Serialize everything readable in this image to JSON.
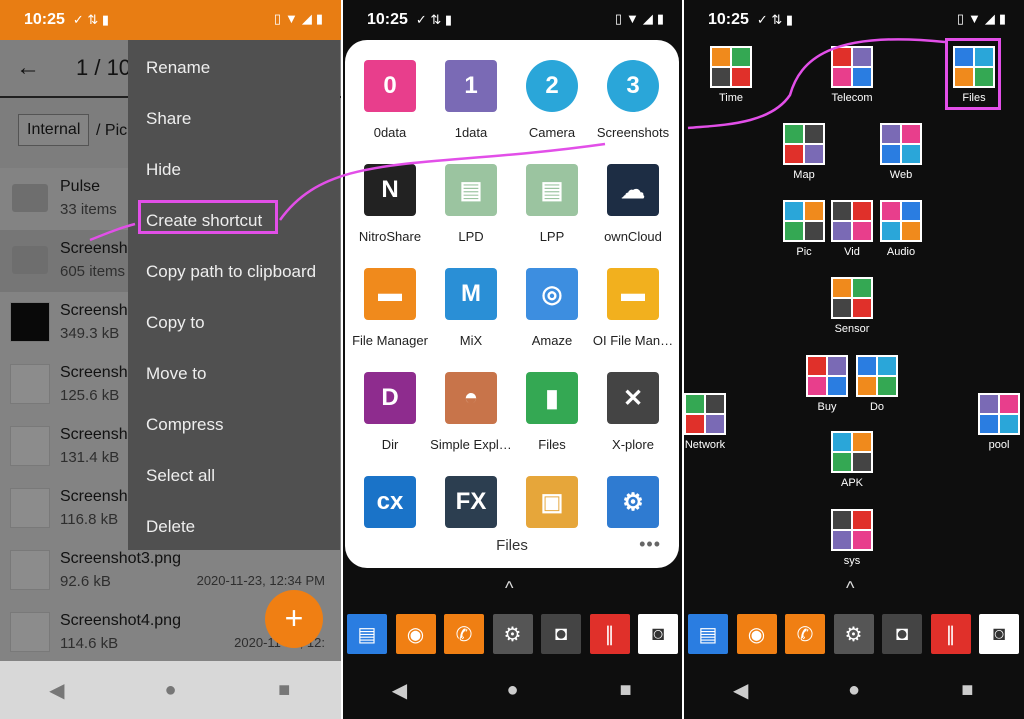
{
  "panel1": {
    "status": {
      "time": "10:25"
    },
    "appbar": {
      "back": "←",
      "title": "1 / 10"
    },
    "breadcrumb": {
      "root": "Internal",
      "path": "/ Pic"
    },
    "rows": [
      {
        "name": "Pulse",
        "size": "33 items",
        "date": ""
      },
      {
        "name": "Screensh",
        "size": "605 items",
        "date": ""
      },
      {
        "name": "Screensh",
        "size": "349.3 kB",
        "date": ""
      },
      {
        "name": "Screensh",
        "size": "125.6 kB",
        "date": ""
      },
      {
        "name": "Screensh",
        "size": "131.4 kB",
        "date": ""
      },
      {
        "name": "Screensh",
        "size": "116.8 kB",
        "date": ""
      },
      {
        "name": "Screenshot3.png",
        "size": "92.6 kB",
        "date": "2020-11-23, 12:34 PM"
      },
      {
        "name": "Screenshot4.png",
        "size": "114.6 kB",
        "date": "2020-11-23, 12:"
      }
    ],
    "menu": [
      "Rename",
      "Share",
      "Hide",
      "Create shortcut",
      "Copy path to clipboard",
      "Copy to",
      "Move to",
      "Compress",
      "Select all",
      "Delete"
    ],
    "fab": "+",
    "nav": [
      "◀",
      "●",
      "■"
    ]
  },
  "panel2": {
    "status": {
      "time": "10:25"
    },
    "apps": [
      {
        "label": "0data",
        "glyph": "0",
        "color": "#e83e8c"
      },
      {
        "label": "1data",
        "glyph": "1",
        "color": "#7a6ab5"
      },
      {
        "label": "Camera",
        "glyph": "2",
        "color": "#2aa6d9"
      },
      {
        "label": "Screenshots",
        "glyph": "3",
        "color": "#2aa6d9"
      },
      {
        "label": "NitroShare",
        "glyph": "N",
        "color": "#222"
      },
      {
        "label": "LPD",
        "glyph": "▤",
        "color": "#9bc4a0"
      },
      {
        "label": "LPP",
        "glyph": "▤",
        "color": "#9bc4a0"
      },
      {
        "label": "ownCloud",
        "glyph": "☁",
        "color": "#1d2d44"
      },
      {
        "label": "File Manager",
        "glyph": "▬",
        "color": "#f08a1c"
      },
      {
        "label": "MiX",
        "glyph": "M",
        "color": "#2a8fd6"
      },
      {
        "label": "Amaze",
        "glyph": "◎",
        "color": "#3d8ee0"
      },
      {
        "label": "OI File Man…",
        "glyph": "▬",
        "color": "#f2b01e"
      },
      {
        "label": "Dir",
        "glyph": "D",
        "color": "#8e2c8e"
      },
      {
        "label": "Simple Expl…",
        "glyph": "◓",
        "color": "#c8744a"
      },
      {
        "label": "Files",
        "glyph": "▮",
        "color": "#34a853"
      },
      {
        "label": "X-plore",
        "glyph": "✕",
        "color": "#444"
      },
      {
        "label": "",
        "glyph": "cx",
        "color": "#1a73c8"
      },
      {
        "label": "",
        "glyph": "FX",
        "color": "#2c3e50"
      },
      {
        "label": "",
        "glyph": "▣",
        "color": "#e6a63a"
      },
      {
        "label": "",
        "glyph": "⚙",
        "color": "#2f7bd1"
      }
    ],
    "folder_title": "Files",
    "more": "•••",
    "chevron": "^",
    "nav": [
      "◀",
      "●",
      "■"
    ]
  },
  "panel3": {
    "status": {
      "time": "10:25"
    },
    "tiles": [
      {
        "label": "Time"
      },
      {
        "label": "Telecom"
      },
      {
        "label": "Files"
      },
      {
        "label": "Map"
      },
      {
        "label": "Web"
      },
      {
        "label": "Pic"
      },
      {
        "label": "Vid"
      },
      {
        "label": "Audio"
      },
      {
        "label": "Sensor"
      },
      {
        "label": "Buy"
      },
      {
        "label": "Do"
      },
      {
        "label": "Network"
      },
      {
        "label": "pool"
      },
      {
        "label": "APK"
      },
      {
        "label": "sys"
      }
    ],
    "chevron": "^",
    "nav": [
      "◀",
      "●",
      "■"
    ]
  },
  "dock": [
    {
      "name": "messages",
      "glyph": "▤",
      "color": "#2a7de1"
    },
    {
      "name": "contacts",
      "glyph": "◉",
      "color": "#f07f13"
    },
    {
      "name": "phone",
      "glyph": "✆",
      "color": "#f07f13"
    },
    {
      "name": "network-tools",
      "glyph": "⚙",
      "color": "#555"
    },
    {
      "name": "dashcam",
      "glyph": "◘",
      "color": "#444"
    },
    {
      "name": "recorder",
      "glyph": "∥",
      "color": "#e0302a"
    },
    {
      "name": "camera",
      "glyph": "◙",
      "color": "#fff"
    }
  ]
}
